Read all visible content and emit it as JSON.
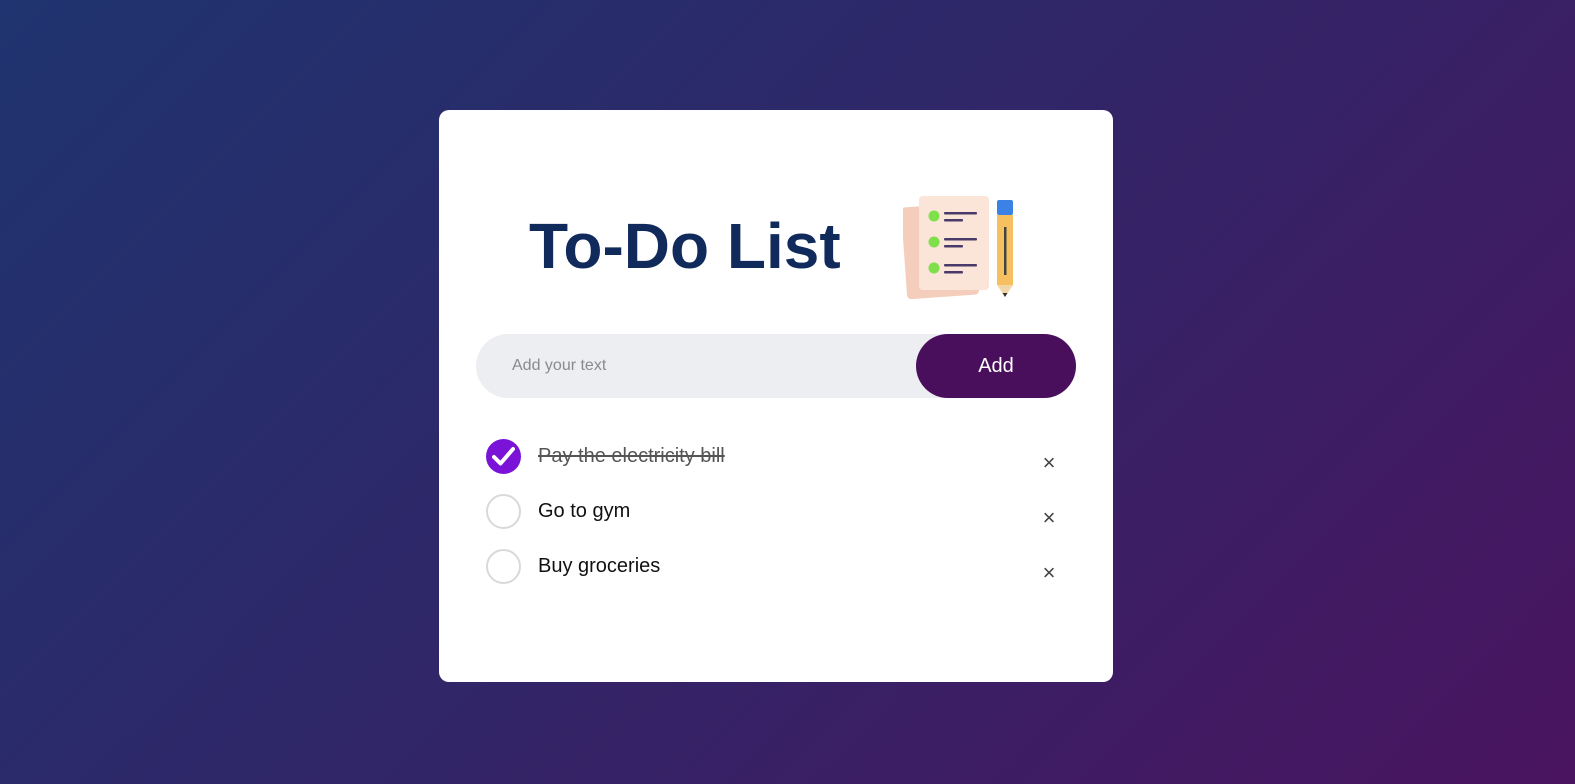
{
  "app": {
    "title": "To-Do List"
  },
  "input": {
    "placeholder": "Add your text",
    "value": ""
  },
  "add_button": {
    "label": "Add"
  },
  "tasks": [
    {
      "text": "Pay the electricity bill",
      "done": true
    },
    {
      "text": "Go to gym",
      "done": false
    },
    {
      "text": "Buy groceries",
      "done": false
    }
  ],
  "remove_glyph": "×",
  "icons": {
    "header": "checklist-with-pencil-icon",
    "check": "checkmark-icon",
    "remove": "close-icon"
  },
  "colors": {
    "title": "#102a5c",
    "add_button": "#4a0f5c",
    "checked": "#7b12d8",
    "input_bg": "#eceef1"
  }
}
